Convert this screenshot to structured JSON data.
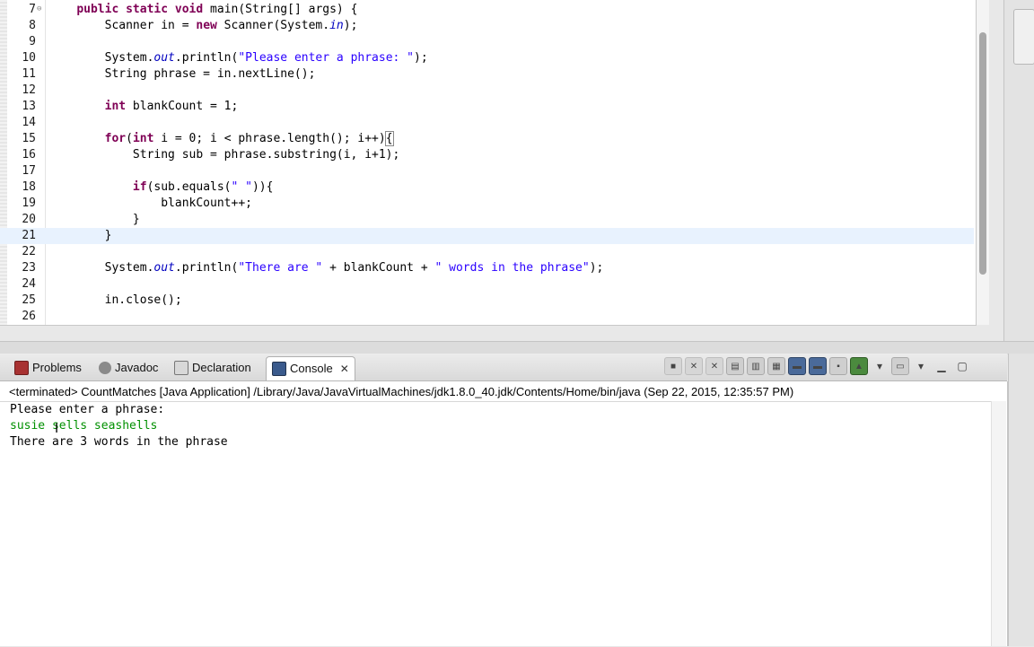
{
  "editor": {
    "lines": [
      {
        "n": "7",
        "fold": "⊖",
        "parts": [
          [
            "",
            "    "
          ],
          [
            "kw",
            "public"
          ],
          [
            "",
            " "
          ],
          [
            "kw",
            "static"
          ],
          [
            "",
            " "
          ],
          [
            "kw",
            "void"
          ],
          [
            "",
            " main(String[] args) {"
          ]
        ]
      },
      {
        "n": "8",
        "parts": [
          [
            "",
            "        Scanner in = "
          ],
          [
            "kw",
            "new"
          ],
          [
            "",
            " Scanner(System."
          ],
          [
            "fld",
            "in"
          ],
          [
            "",
            ");"
          ]
        ]
      },
      {
        "n": "9",
        "parts": [
          [
            "",
            ""
          ]
        ]
      },
      {
        "n": "10",
        "parts": [
          [
            "",
            "        System."
          ],
          [
            "fld",
            "out"
          ],
          [
            "",
            ".println("
          ],
          [
            "str",
            "\"Please enter a phrase: \""
          ],
          [
            "",
            ");"
          ]
        ]
      },
      {
        "n": "11",
        "parts": [
          [
            "",
            "        String phrase = in.nextLine();"
          ]
        ]
      },
      {
        "n": "12",
        "parts": [
          [
            "",
            ""
          ]
        ]
      },
      {
        "n": "13",
        "parts": [
          [
            "",
            "        "
          ],
          [
            "kw",
            "int"
          ],
          [
            "",
            " blankCount = 1;"
          ]
        ]
      },
      {
        "n": "14",
        "parts": [
          [
            "",
            ""
          ]
        ]
      },
      {
        "n": "15",
        "parts": [
          [
            "",
            "        "
          ],
          [
            "kw",
            "for"
          ],
          [
            "",
            "("
          ],
          [
            "kw",
            "int"
          ],
          [
            "",
            " i = 0; i < phrase.length(); i++)"
          ],
          [
            "box",
            "{"
          ]
        ]
      },
      {
        "n": "16",
        "parts": [
          [
            "",
            "            String sub = phrase.substring(i, i+1);"
          ]
        ]
      },
      {
        "n": "17",
        "parts": [
          [
            "",
            ""
          ]
        ]
      },
      {
        "n": "18",
        "parts": [
          [
            "",
            "            "
          ],
          [
            "kw",
            "if"
          ],
          [
            "",
            "(sub.equals("
          ],
          [
            "str",
            "\" \""
          ],
          [
            "",
            "))"
          ],
          [
            "",
            "{"
          ]
        ]
      },
      {
        "n": "19",
        "parts": [
          [
            "",
            "                blankCount++;"
          ]
        ]
      },
      {
        "n": "20",
        "parts": [
          [
            "",
            "            }"
          ]
        ]
      },
      {
        "n": "21",
        "current": true,
        "parts": [
          [
            "",
            "        }"
          ]
        ]
      },
      {
        "n": "22",
        "parts": [
          [
            "",
            ""
          ]
        ]
      },
      {
        "n": "23",
        "parts": [
          [
            "",
            "        System."
          ],
          [
            "fld",
            "out"
          ],
          [
            "",
            ".println("
          ],
          [
            "str",
            "\"There are \""
          ],
          [
            "",
            " + blankCount + "
          ],
          [
            "str",
            "\" words in the phrase\""
          ],
          [
            "",
            ");"
          ]
        ]
      },
      {
        "n": "24",
        "parts": [
          [
            "",
            ""
          ]
        ]
      },
      {
        "n": "25",
        "parts": [
          [
            "",
            "        in.close();"
          ]
        ]
      },
      {
        "n": "26",
        "parts": [
          [
            "",
            ""
          ]
        ]
      }
    ]
  },
  "views": {
    "tabs": [
      {
        "key": "problems",
        "label": "Problems",
        "icon": "problems-icon"
      },
      {
        "key": "javadoc",
        "label": "Javadoc",
        "icon": "javadoc-icon"
      },
      {
        "key": "declaration",
        "label": "Declaration",
        "icon": "declaration-icon"
      },
      {
        "key": "console",
        "label": "Console",
        "icon": "console-icon",
        "active": true
      }
    ]
  },
  "console": {
    "status": "<terminated> CountMatches [Java Application] /Library/Java/JavaVirtualMachines/jdk1.8.0_40.jdk/Contents/Home/bin/java (Sep 22, 2015, 12:35:57 PM)",
    "output": [
      {
        "text": "Please enter a phrase:",
        "kind": "stdout"
      },
      {
        "text": "susie sells seashells",
        "kind": "input"
      },
      {
        "text": "There are 3 words in the phrase",
        "kind": "stdout"
      }
    ]
  },
  "colors": {
    "keyword": "#7f0055",
    "string": "#2a00ff",
    "field": "#0000c0",
    "console_input": "#009000",
    "current_line": "#e8f2fe"
  }
}
